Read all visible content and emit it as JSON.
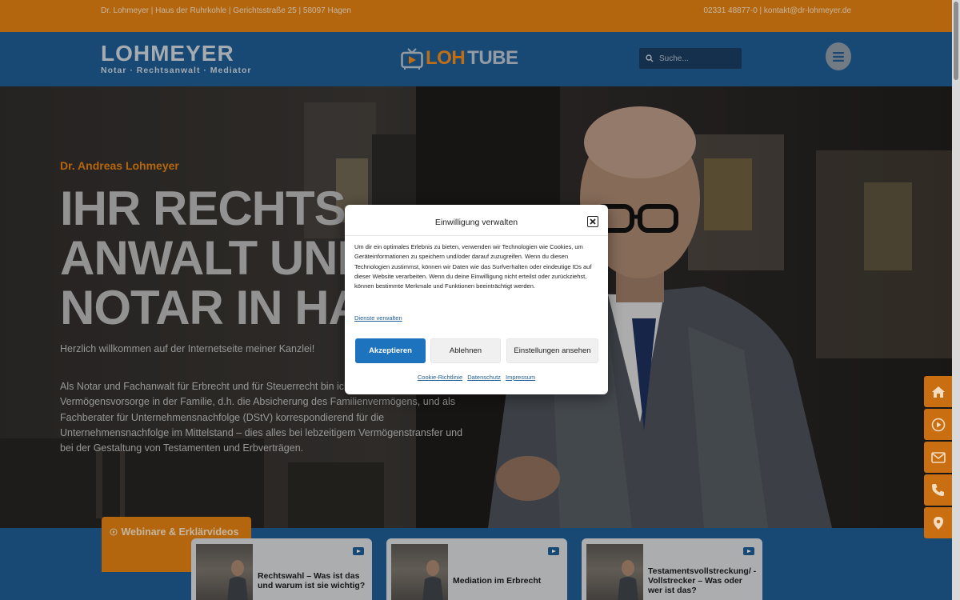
{
  "topbar": {
    "address": "Dr. Lohmeyer | Haus der Ruhrkohle | Gerichtsstraße 25 | 58097 Hagen",
    "contact": "02331 48877-0 | kontakt@dr-lohmeyer.de"
  },
  "header": {
    "logo_name": "LOHMEYER",
    "logo_sub": "Notar · Rechtsanwalt · Mediator",
    "lohtube_a": "LOH",
    "lohtube_b": "TUBE",
    "search_placeholder": "Suche..."
  },
  "hero": {
    "kicker": "Dr. Andreas Lohmeyer",
    "headline_1": "IHR RECHTS-",
    "headline_2": "ANWALT UND",
    "headline_3": "NOTAR IN HAGEN",
    "welcome": "Herzlich willkommen auf der Internetseite meiner Kanzlei!",
    "paragraph": "Als Notar und Fachanwalt für Erbrecht und für Steuerrecht bin ich Spezialist für die Vermögensvorsorge in der Familie, d.h. die Absicherung des Familienvermögens, und als Fachberater für Unternehmensnachfolge (DStV) korrespondierend für die Unternehmensnachfolge im Mittelstand – dies alles bei lebzeitigem Vermögenstransfer und bei der Gestaltung von Testamenten und Erbverträgen."
  },
  "webinar": {
    "tab_label": "Webinare & Erklärvideos",
    "cards": [
      {
        "title": "Rechtswahl – Was ist das und warum ist sie wichtig?"
      },
      {
        "title": "Mediation im Erbrecht"
      },
      {
        "title": "Testamentsvollstreckung/ - Vollstrecker – Was oder wer ist das?"
      }
    ]
  },
  "consent": {
    "title": "Einwilligung verwalten",
    "text": "Um dir ein optimales Erlebnis zu bieten, verwenden wir Technologien wie Cookies, um Geräteinformationen zu speichern und/oder darauf zuzugreifen. Wenn du diesen Technologien zustimmst, können wir Daten wie das Surfverhalten oder eindeutige IDs auf dieser Website verarbeiten. Wenn du deine Einwilligung nicht erteilst oder zurückziehst, können bestimmte Merkmale und Funktionen beeinträchtigt werden.",
    "manage_link": "Dienste verwalten",
    "accept_label": "Akzeptieren",
    "deny_label": "Ablehnen",
    "settings_label": "Einstellungen ansehen",
    "link_cookie": "Cookie-Richtlinie",
    "link_privacy": "Datenschutz",
    "link_imprint": "Impressum"
  },
  "colors": {
    "orange": "#e08012",
    "blue": "#1f5c93",
    "accept_blue": "#1e73be"
  },
  "side_icons": [
    "home-icon",
    "play-icon",
    "mail-icon",
    "phone-icon",
    "location-icon"
  ]
}
